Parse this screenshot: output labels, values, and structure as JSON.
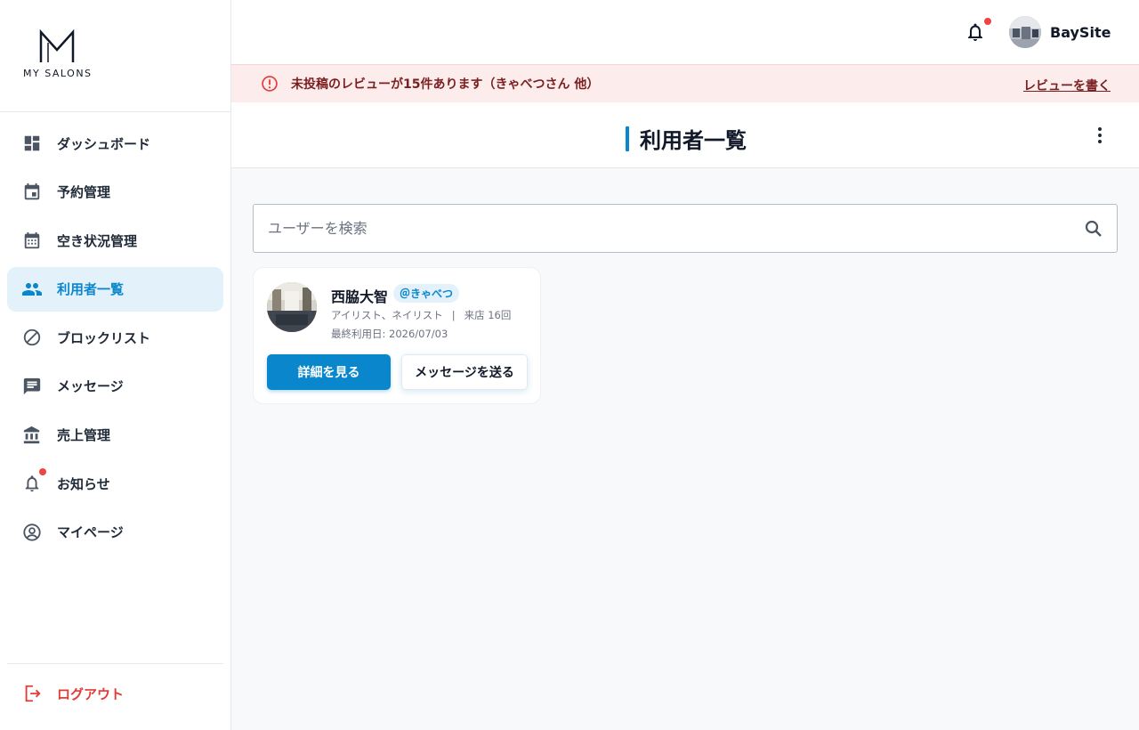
{
  "app": {
    "logo_text": "MY SALONS"
  },
  "sidebar": {
    "items": [
      {
        "label": "ダッシュボード",
        "icon": "dashboard-icon",
        "active": false
      },
      {
        "label": "予約管理",
        "icon": "calendar-event-icon",
        "active": false
      },
      {
        "label": "空き状況管理",
        "icon": "calendar-grid-icon",
        "active": false
      },
      {
        "label": "利用者一覧",
        "icon": "people-icon",
        "active": true
      },
      {
        "label": "ブロックリスト",
        "icon": "block-icon",
        "active": false
      },
      {
        "label": "メッセージ",
        "icon": "chat-icon",
        "active": false
      },
      {
        "label": "売上管理",
        "icon": "bank-icon",
        "active": false
      },
      {
        "label": "お知らせ",
        "icon": "bell-icon",
        "active": false,
        "has_dot": true
      },
      {
        "label": "マイページ",
        "icon": "account-circle-icon",
        "active": false
      }
    ],
    "logout_label": "ログアウト"
  },
  "header": {
    "user_name": "BaySite",
    "has_notification": true
  },
  "alert": {
    "message": "未投稿のレビューが15件あります（きゃべつさん 他）",
    "link_label": "レビューを書く"
  },
  "page": {
    "title": "利用者一覧"
  },
  "search": {
    "placeholder": "ユーザーを検索",
    "value": ""
  },
  "users": [
    {
      "name": "西脇大智",
      "handle": "＠きゃべつ",
      "services": "アイリスト、ネイリスト",
      "separator": "|",
      "visits": "来店 16回",
      "last_used": "最終利用日: 2026/07/03",
      "detail_label": "詳細を見る",
      "message_label": "メッセージを送る"
    }
  ],
  "colors": {
    "accent": "#0a87cc",
    "accent_light": "#e3f1fb",
    "alert_bg": "#fdecec",
    "alert_text": "#7a1f1f",
    "danger": "#e53935",
    "notification_dot": "#ef4444"
  }
}
